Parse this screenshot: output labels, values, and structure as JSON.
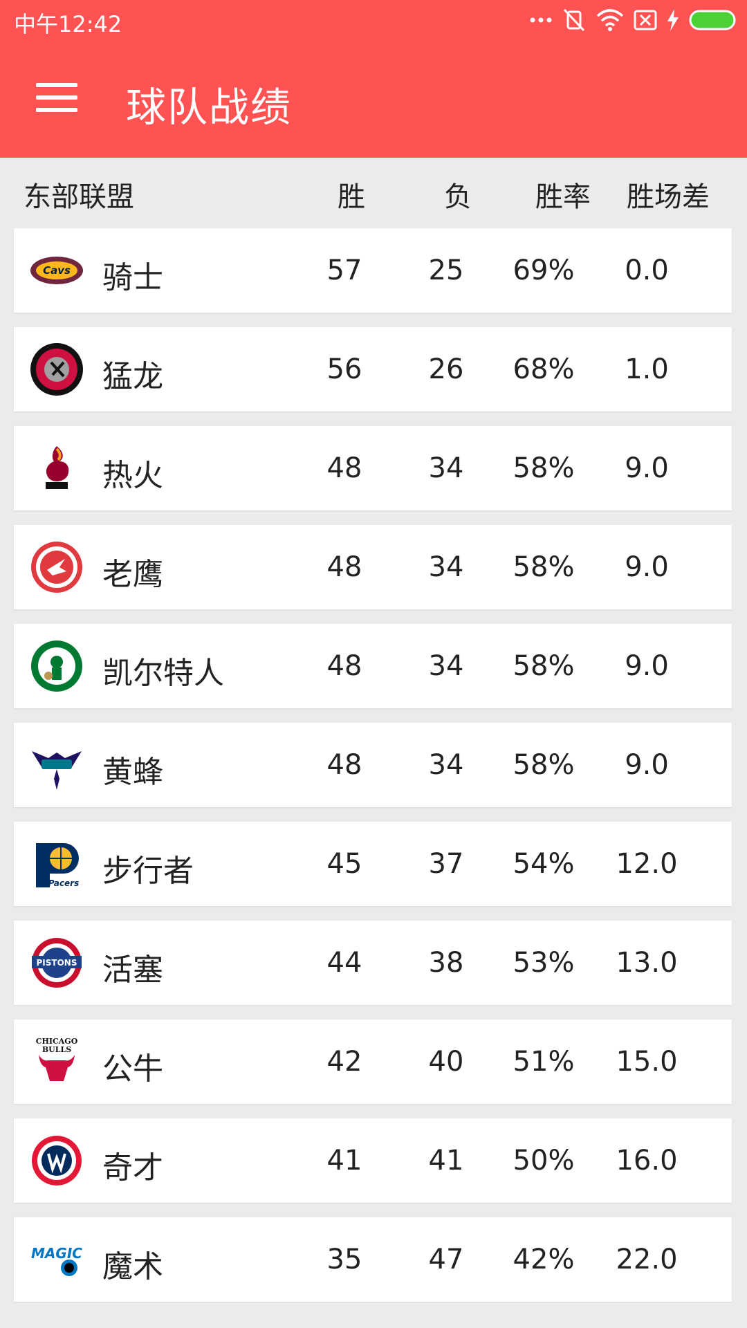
{
  "status_bar": {
    "time": "中午12:42",
    "icons": [
      "more-dots-icon",
      "vibrate-off-icon",
      "wifi-icon",
      "sim-off-icon",
      "charging-bolt-icon",
      "battery-icon"
    ],
    "battery_color": "#4cd137"
  },
  "app_bar": {
    "title": "球队战绩",
    "background_color": "#ff5252",
    "menu_icon": "hamburger-menu-icon"
  },
  "table": {
    "headers": {
      "conference": "东部联盟",
      "wins": "胜",
      "losses": "负",
      "win_pct": "胜率",
      "games_behind": "胜场差"
    },
    "rows": [
      {
        "team": "骑士",
        "logo": "cavaliers-logo",
        "wins": "57",
        "losses": "25",
        "pct": "69%",
        "gb": "0.0"
      },
      {
        "team": "猛龙",
        "logo": "raptors-logo",
        "wins": "56",
        "losses": "26",
        "pct": "68%",
        "gb": "1.0"
      },
      {
        "team": "热火",
        "logo": "heat-logo",
        "wins": "48",
        "losses": "34",
        "pct": "58%",
        "gb": "9.0"
      },
      {
        "team": "老鹰",
        "logo": "hawks-logo",
        "wins": "48",
        "losses": "34",
        "pct": "58%",
        "gb": "9.0"
      },
      {
        "team": "凯尔特人",
        "logo": "celtics-logo",
        "wins": "48",
        "losses": "34",
        "pct": "58%",
        "gb": "9.0"
      },
      {
        "team": "黄蜂",
        "logo": "hornets-logo",
        "wins": "48",
        "losses": "34",
        "pct": "58%",
        "gb": "9.0"
      },
      {
        "team": "步行者",
        "logo": "pacers-logo",
        "wins": "45",
        "losses": "37",
        "pct": "54%",
        "gb": "12.0"
      },
      {
        "team": "活塞",
        "logo": "pistons-logo",
        "wins": "44",
        "losses": "38",
        "pct": "53%",
        "gb": "13.0"
      },
      {
        "team": "公牛",
        "logo": "bulls-logo",
        "wins": "42",
        "losses": "40",
        "pct": "51%",
        "gb": "15.0"
      },
      {
        "team": "奇才",
        "logo": "wizards-logo",
        "wins": "41",
        "losses": "41",
        "pct": "50%",
        "gb": "16.0"
      },
      {
        "team": "魔术",
        "logo": "magic-logo",
        "wins": "35",
        "losses": "47",
        "pct": "42%",
        "gb": "22.0"
      }
    ]
  }
}
